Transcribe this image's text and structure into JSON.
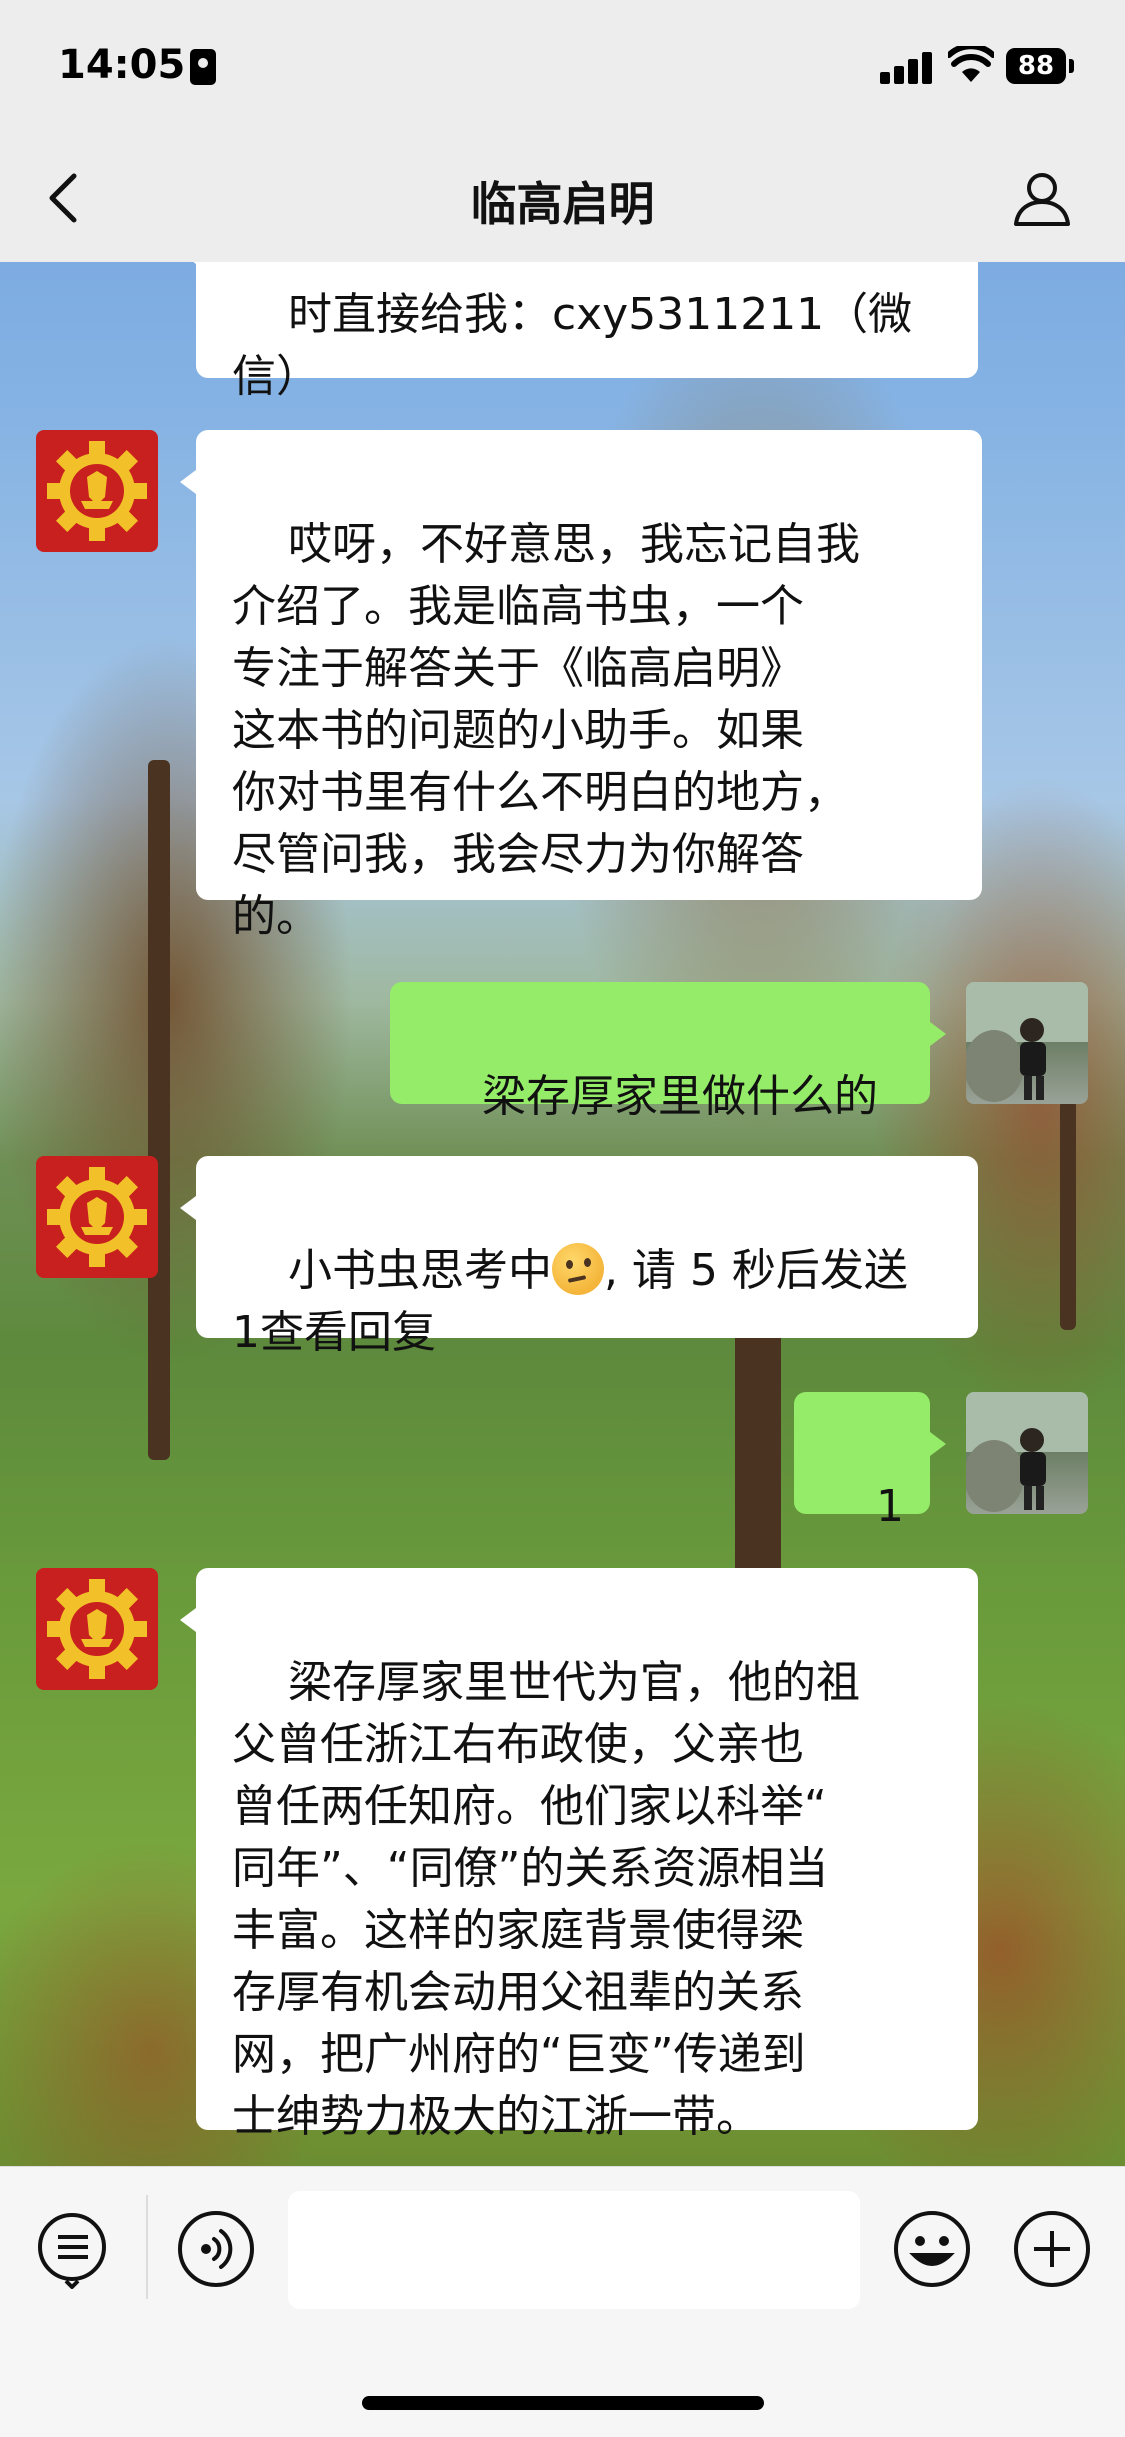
{
  "status": {
    "time": "14:05",
    "battery": "88"
  },
  "nav": {
    "title": "临高启明"
  },
  "messages": [
    {
      "from": "bot",
      "text": "时直接给我：cxy5311211（微\n信）"
    },
    {
      "from": "bot",
      "text": "哎呀，不好意思，我忘记自我\n介绍了。我是临高书虫，一个\n专注于解答关于《临高启明》\n这本书的问题的小助手。如果\n你对书里有什么不明白的地方，\n尽管问我，我会尽力为你解答\n的。"
    },
    {
      "from": "user",
      "text": "梁存厚家里做什么的"
    },
    {
      "from": "bot",
      "text_before": "小书虫思考中",
      "emoji": "thinking-face",
      "text_after": ", 请 5 秒后发送\n1查看回复"
    },
    {
      "from": "user",
      "text": "1"
    },
    {
      "from": "bot",
      "text": "梁存厚家里世代为官，他的祖\n父曾任浙江右布政使，父亲也\n曾任两任知府。他们家以科举“\n同年”、“同僚”的关系资源相当\n丰富。这样的家庭背景使得梁\n存厚有机会动用父祖辈的关系\n网，把广州府的“巨变”传递到\n士绅势力极大的江浙一带。"
    }
  ],
  "input": {
    "value": ""
  },
  "icons": {
    "menu": "list-menu-icon",
    "voice": "voice-icon",
    "emoji": "emoji-icon",
    "more": "plus-icon",
    "back": "chevron-left-icon",
    "profile": "person-icon"
  },
  "colors": {
    "bubble_user": "#95ec69",
    "bubble_bot": "#ffffff",
    "bot_avatar": "#c8201e",
    "bot_avatar_emblem": "#f2c029",
    "bar": "#ededed"
  }
}
